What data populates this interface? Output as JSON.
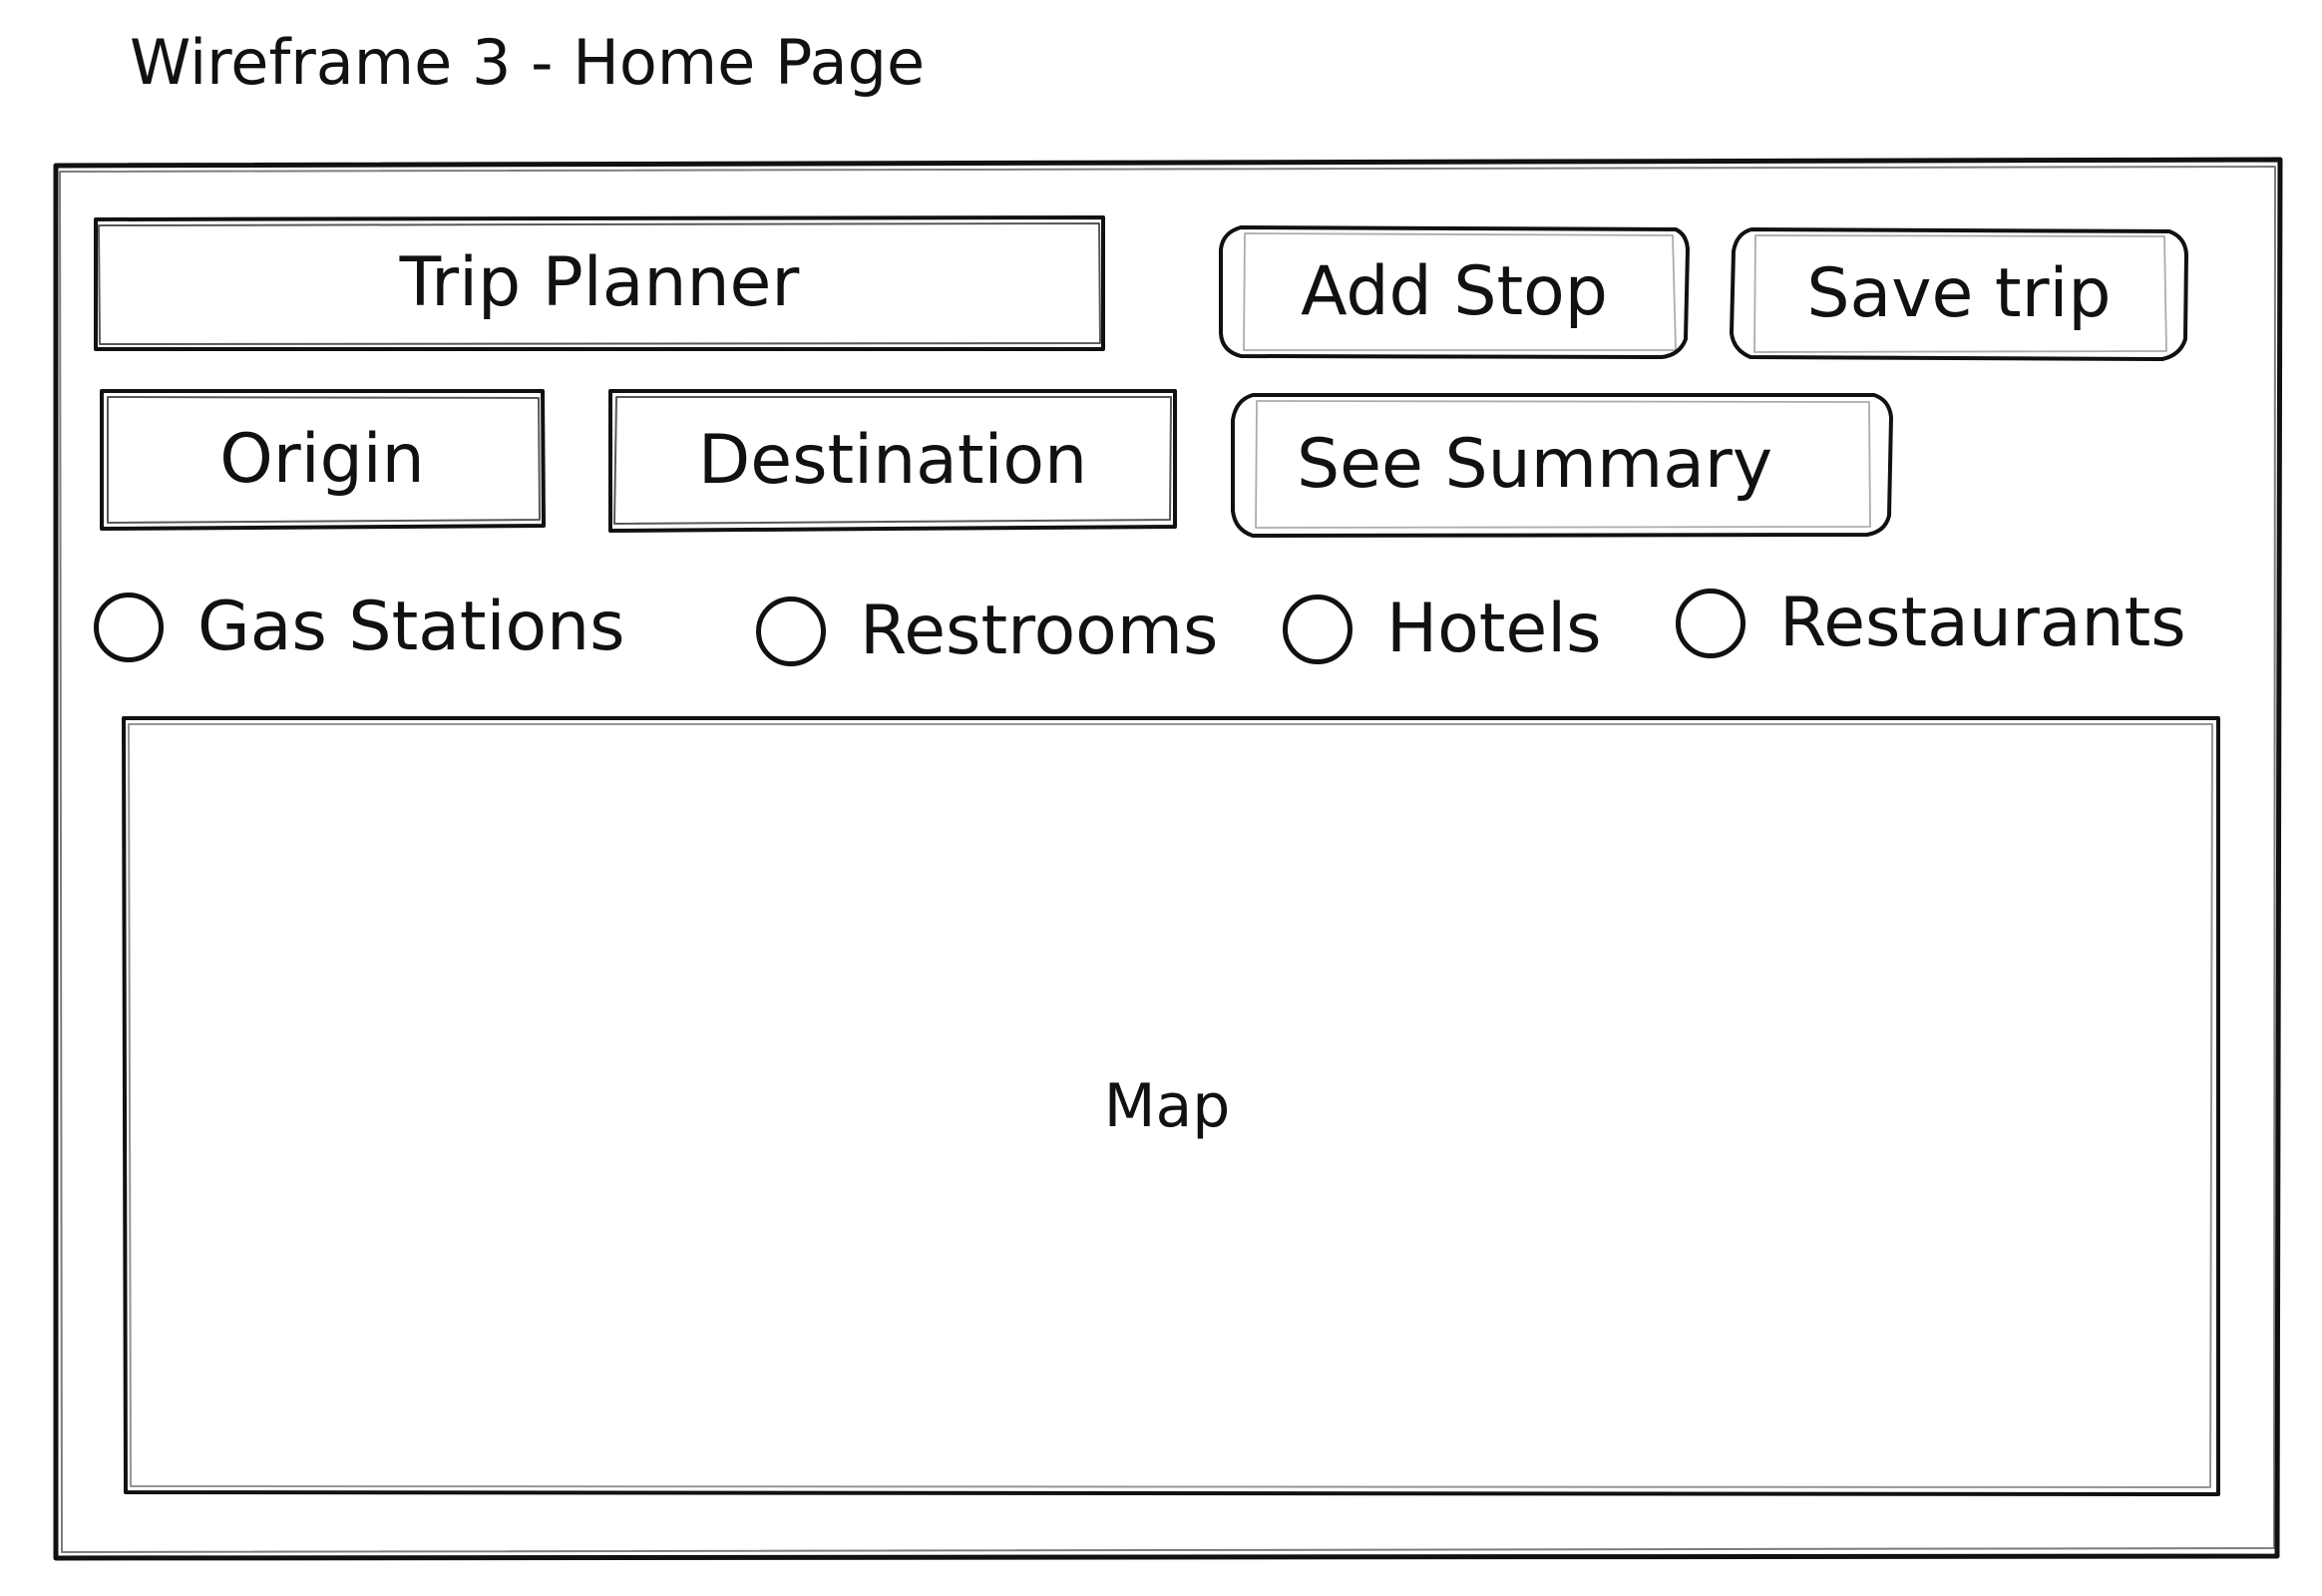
{
  "title": "Wireframe 3 - Home Page",
  "header": {
    "app_title": "Trip Planner",
    "add_stop_label": "Add Stop",
    "save_trip_label": "Save trip"
  },
  "route_inputs": {
    "origin_label": "Origin",
    "destination_label": "Destination",
    "summary_label": "See Summary"
  },
  "filters": [
    {
      "label": "Gas Stations",
      "selected": false
    },
    {
      "label": "Restrooms",
      "selected": false
    },
    {
      "label": "Hotels",
      "selected": false
    },
    {
      "label": "Restaurants",
      "selected": false
    }
  ],
  "map": {
    "label": "Map"
  },
  "style": {
    "ink_color": "#111111",
    "background_color": "#ffffff"
  }
}
